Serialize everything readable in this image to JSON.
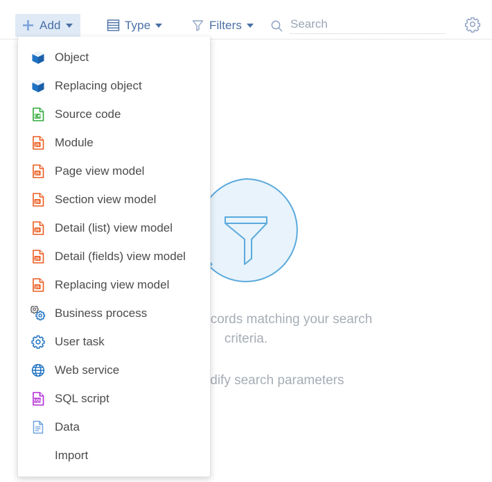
{
  "colors": {
    "accent": "#4a6fa5",
    "add_button_bg": "#dfeaf6",
    "menu_text": "#4b4b4b",
    "empty_text": "#a6adb6",
    "bubble_fill": "#e8f3fb",
    "bubble_stroke": "#5aa9dd",
    "icon_blue": "#1f73c4",
    "icon_green": "#2eaa3c",
    "icon_orange": "#eb5b1e",
    "icon_purple": "#b32bd4",
    "icon_doc_blue": "#6ea3dd"
  },
  "toolbar": {
    "add": {
      "label": "Add",
      "icon": "plus-icon",
      "caret": true,
      "active": true
    },
    "type": {
      "label": "Type",
      "icon": "rows-icon",
      "caret": true
    },
    "filters": {
      "label": "Filters",
      "icon": "funnel-icon",
      "caret": true
    },
    "search": {
      "placeholder": "Search",
      "value": "",
      "icon": "search-icon"
    },
    "settings": {
      "icon": "gear-icon"
    }
  },
  "add_menu": {
    "items": [
      {
        "label": "Object",
        "icon": "cube-icon"
      },
      {
        "label": "Replacing object",
        "icon": "cube-icon"
      },
      {
        "label": "Source code",
        "icon": "csharp-file-icon"
      },
      {
        "label": "Module",
        "icon": "js-file-icon"
      },
      {
        "label": "Page view model",
        "icon": "js-file-icon"
      },
      {
        "label": "Section view model",
        "icon": "js-file-icon"
      },
      {
        "label": "Detail (list) view model",
        "icon": "js-file-icon"
      },
      {
        "label": "Detail (fields) view model",
        "icon": "js-file-icon"
      },
      {
        "label": "Replacing view model",
        "icon": "js-file-icon"
      },
      {
        "label": "Business process",
        "icon": "double-gear-icon"
      },
      {
        "label": "User task",
        "icon": "gear-icon"
      },
      {
        "label": "Web service",
        "icon": "globe-icon"
      },
      {
        "label": "SQL script",
        "icon": "sql-file-icon"
      },
      {
        "label": "Data",
        "icon": "document-icon"
      },
      {
        "label": "Import",
        "icon": "none"
      }
    ]
  },
  "empty_state": {
    "illustration": "speech-bubble-funnel-icon",
    "message": "There are no records matching your search criteria.",
    "submessage": "Please modify search parameters"
  }
}
